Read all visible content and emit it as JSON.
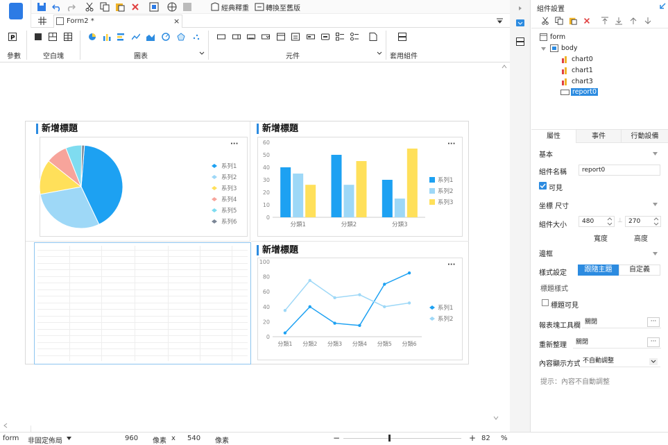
{
  "sidebar": {
    "params_label": "參數"
  },
  "toolbar": {
    "classic_label": "經典釋重",
    "convert_label": "轉換至舊版"
  },
  "tab": {
    "title": "Form2 *"
  },
  "ribbon": {
    "blank_label": "空白塊",
    "chart_label": "圖表",
    "widget_label": "元件",
    "apply_label": "套用組件"
  },
  "chart0": {
    "title": "新增標題",
    "more": "···"
  },
  "chart1": {
    "title": "新增標題",
    "more": "···"
  },
  "chart3": {
    "title": "新增標題",
    "more": "···"
  },
  "chart_data": [
    {
      "type": "pie",
      "series": [
        {
          "name": "系列1",
          "value": 40
        },
        {
          "name": "系列2",
          "value": 28
        },
        {
          "name": "系列3",
          "value": 13
        },
        {
          "name": "系列4",
          "value": 8
        },
        {
          "name": "系列5",
          "value": 6
        },
        {
          "name": "系列6",
          "value": 1
        }
      ],
      "colors": [
        "#1da1f2",
        "#9ed8f7",
        "#ffe05a",
        "#f7a49b",
        "#7fdcf0",
        "#7b8696"
      ]
    },
    {
      "type": "bar",
      "categories": [
        "分類1",
        "分類2",
        "分類3"
      ],
      "series": [
        {
          "name": "系列1",
          "values": [
            40,
            50,
            30
          ]
        },
        {
          "name": "系列2",
          "values": [
            35,
            26,
            15
          ]
        },
        {
          "name": "系列3",
          "values": [
            26,
            45,
            55
          ]
        }
      ],
      "ylim": [
        0,
        60
      ],
      "yticks": [
        0,
        10,
        20,
        30,
        40,
        50,
        60
      ],
      "colors": [
        "#1da1f2",
        "#9ed8f7",
        "#ffe05a"
      ]
    },
    {
      "type": "line",
      "categories": [
        "分類1",
        "分類2",
        "分類3",
        "分類4",
        "分類5",
        "分類6"
      ],
      "series": [
        {
          "name": "系列1",
          "values": [
            5,
            40,
            18,
            15,
            70,
            85
          ]
        },
        {
          "name": "系列2",
          "values": [
            35,
            75,
            52,
            56,
            40,
            45
          ]
        }
      ],
      "ylim": [
        0,
        100
      ],
      "yticks": [
        0,
        20,
        40,
        60,
        80,
        100
      ],
      "colors": [
        "#1da1f2",
        "#9ed8f7"
      ]
    }
  ],
  "panel": {
    "title": "組件設置",
    "tree": {
      "form": "form",
      "body": "body",
      "chart0": "chart0",
      "chart1": "chart1",
      "chart3": "chart3",
      "report0": "report0"
    },
    "tabs": [
      "屬性",
      "事件",
      "行動設備"
    ],
    "basic": "基本",
    "name_label": "組件名稱",
    "name_value": "report0",
    "visible_label": "可見",
    "coord_label": "坐標 尺寸",
    "size_label": "組件大小",
    "width_value": "480",
    "height_value": "270",
    "width_caption": "寬度",
    "height_caption": "高度",
    "border_label": "邊框",
    "style_label": "樣式設定",
    "style_follow": "跟隨主題",
    "style_custom": "自定義",
    "title_style": "標題樣式",
    "title_visible": "標題可見",
    "toolbar_label": "報表塊工具欄",
    "toolbar_value": "關閉",
    "reorg_label": "重新整理",
    "reorg_value": "關閉",
    "display_label": "內容顯示方式",
    "display_value": "不自動調整",
    "hint": "提示：內容不自動調整"
  },
  "status": {
    "form": "form",
    "layout": "非固定佈局",
    "width": "960",
    "unit1": "像素",
    "x": "x",
    "height": "540",
    "unit2": "像素",
    "zoom": "82",
    "pct": "%"
  }
}
